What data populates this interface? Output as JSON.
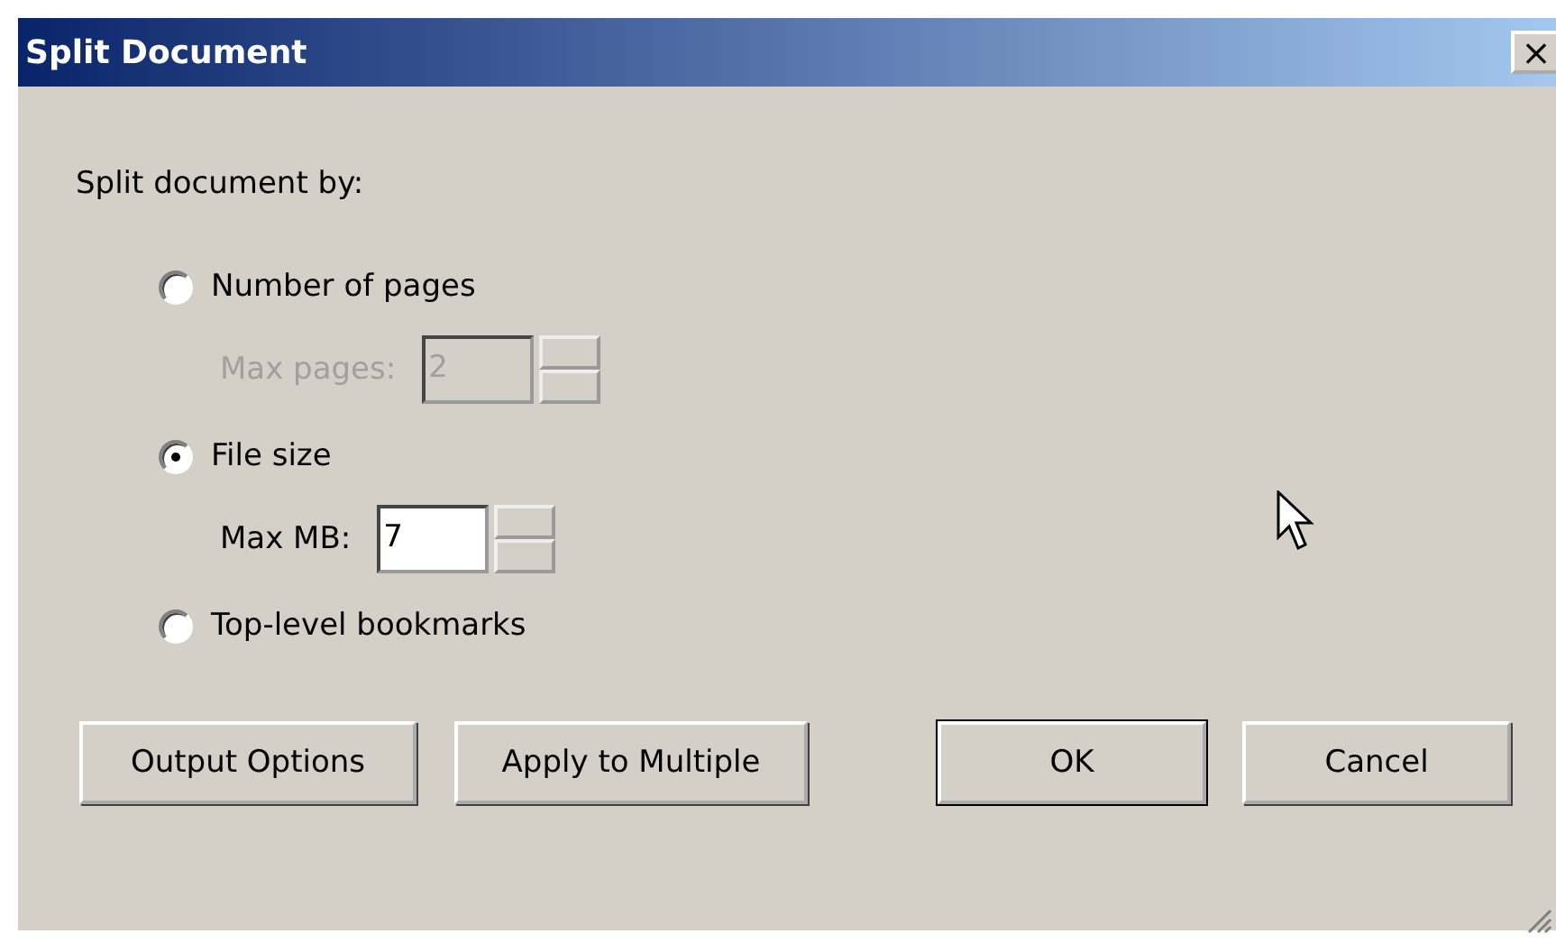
{
  "window": {
    "title": "Split Document",
    "close": "×"
  },
  "prompt": "Split document by:",
  "options": [
    {
      "label": "Number of pages",
      "selected": false,
      "field": {
        "label": "Max pages:",
        "value": "2",
        "disabled": true
      }
    },
    {
      "label": "File size",
      "selected": true,
      "field": {
        "label": "Max MB:",
        "value": "7",
        "disabled": false
      }
    },
    {
      "label": "Top-level bookmarks",
      "selected": false
    }
  ],
  "buttons": [
    {
      "label": "Output Options",
      "default": false
    },
    {
      "label": "Apply to Multiple",
      "default": false
    },
    {
      "label": "OK",
      "default": true
    },
    {
      "label": "Cancel",
      "default": false
    }
  ]
}
